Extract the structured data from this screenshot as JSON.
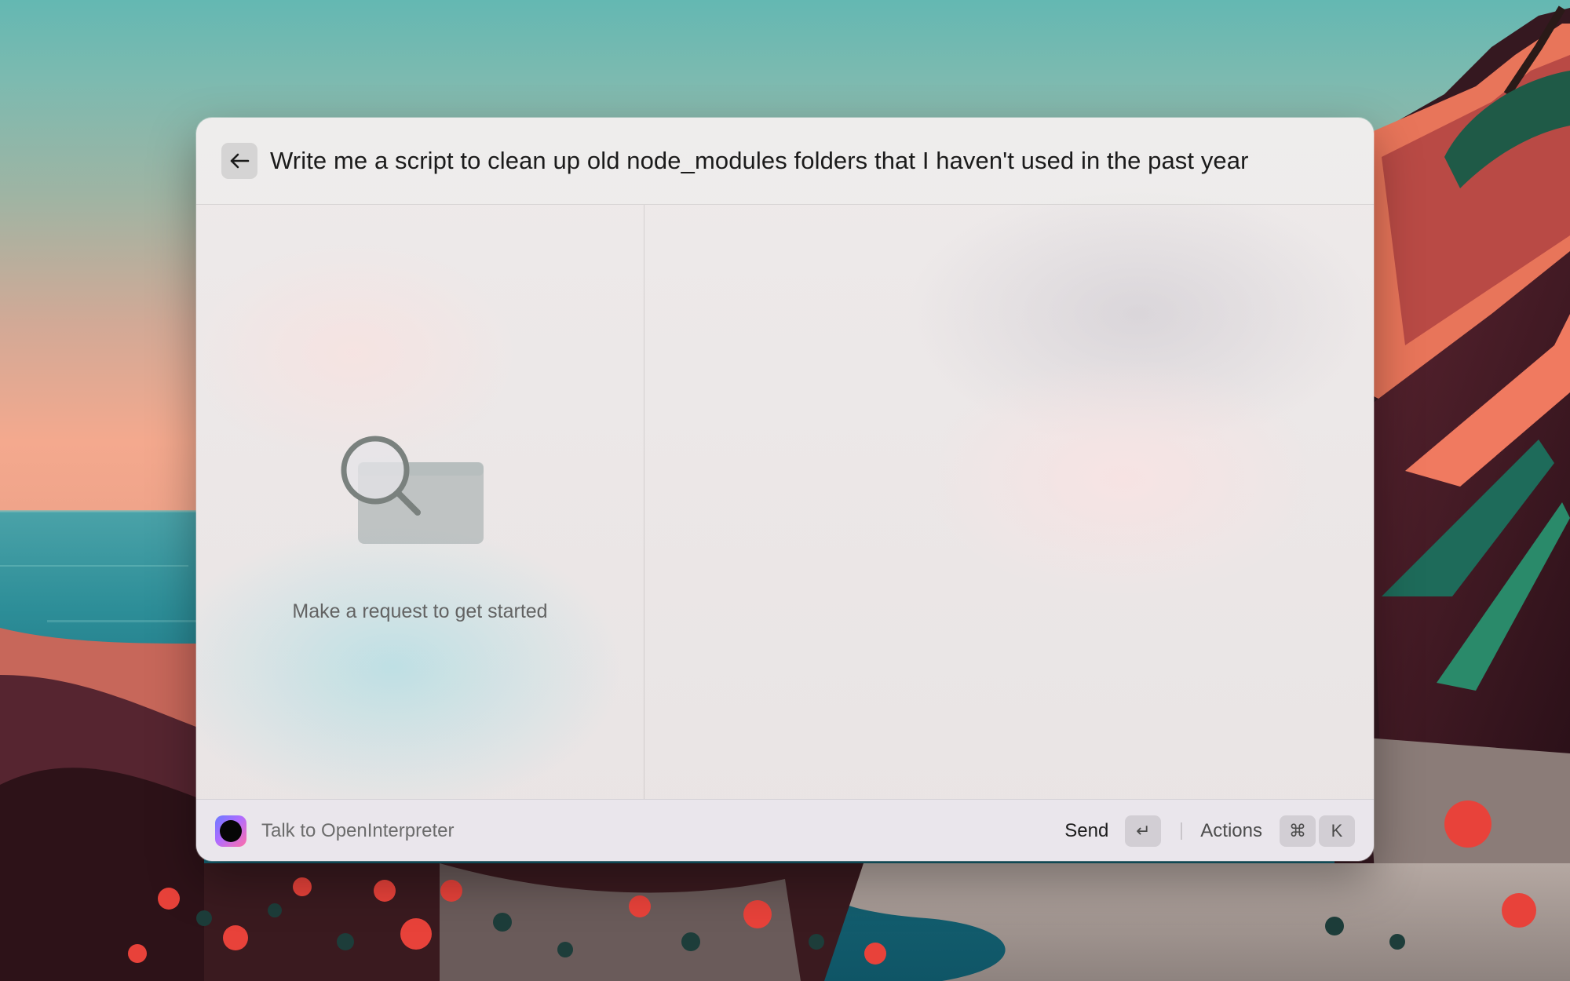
{
  "launcher": {
    "query": "Write me a script to clean up old node_modules folders that I haven't used in the past year",
    "empty_state_message": "Make a request to get started",
    "footer": {
      "app_label": "Talk to OpenInterpreter",
      "send_label": "Send",
      "send_key": "↵",
      "actions_label": "Actions",
      "actions_keys": [
        "⌘",
        "K"
      ]
    }
  },
  "icons": {
    "back": "arrow-left-icon",
    "app": "openinterpreter-icon",
    "empty_state": "magnifier-window-icon"
  },
  "colors": {
    "accent_gradient": [
      "#6a7bff",
      "#b06cff",
      "#ff6fa9"
    ]
  }
}
